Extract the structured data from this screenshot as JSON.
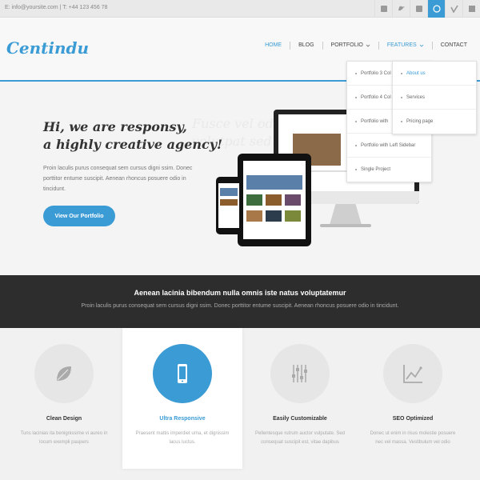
{
  "topbar": {
    "contact": "E: info@yoursite.com | T: +44 123 456 78",
    "social_icons": [
      "rss-icon",
      "twitter-icon",
      "facebook-icon",
      "dribbble-icon",
      "vimeo-icon",
      "flickr-icon"
    ]
  },
  "header": {
    "logo": "Centindu",
    "nav": [
      "HOME",
      "BLOG",
      "PORTFOLIO",
      "FEATURES",
      "CONTACT"
    ]
  },
  "dropdowns": {
    "portfolio": [
      "Portfolio 3 Col",
      "Portfolio 4 Col",
      "Portfolio with",
      "Portfolio with Left Sidebar",
      "Single Project"
    ],
    "features": [
      "About us",
      "Services",
      "Pricing page"
    ]
  },
  "hero": {
    "headline_1": "Hi, we are responsy,",
    "headline_2": "a highly creative agency!",
    "text": "Proin laculis purus consequat sem cursus digni ssim. Donec porttitor entume suscipit. Aenean rhoncus posuere odio in tincidunt.",
    "button": "View Our Portfolio",
    "ghost_text": "Fusce vel odio dui eget auctor eget volutpat sed nod sed odio."
  },
  "band": {
    "title": "Aenean lacinia bibendum nulla omnis iste natus voluptatemur",
    "subtitle": "Proin laculis purus consequat sem cursus digni ssim. Donec porttitor entume suscipit. Aenean rhoncus posuere odio in tincidunt."
  },
  "features": [
    {
      "title": "Clean Design",
      "desc": "Tuns lacinias ita benignissime vi aureo in locum exempli paupers",
      "icon": "leaf-icon"
    },
    {
      "title": "Ultra Responsive",
      "desc": "Praesent mattis imperdiet urna, et dignissim lacus luctus.",
      "icon": "smartphone-icon"
    },
    {
      "title": "Easily Customizable",
      "desc": "Pellentesque rutrum auctor vulputate. Sed consequat suscipit est, vitae dapibus",
      "icon": "sliders-icon"
    },
    {
      "title": "SEO Optimized",
      "desc": "Donec ut enim in risus molestie posuere nec vel massa. Vestibulum vel odio",
      "icon": "chart-icon"
    }
  ],
  "colors": {
    "accent": "#3a9bd5",
    "dark_band": "#2d2d2d"
  }
}
